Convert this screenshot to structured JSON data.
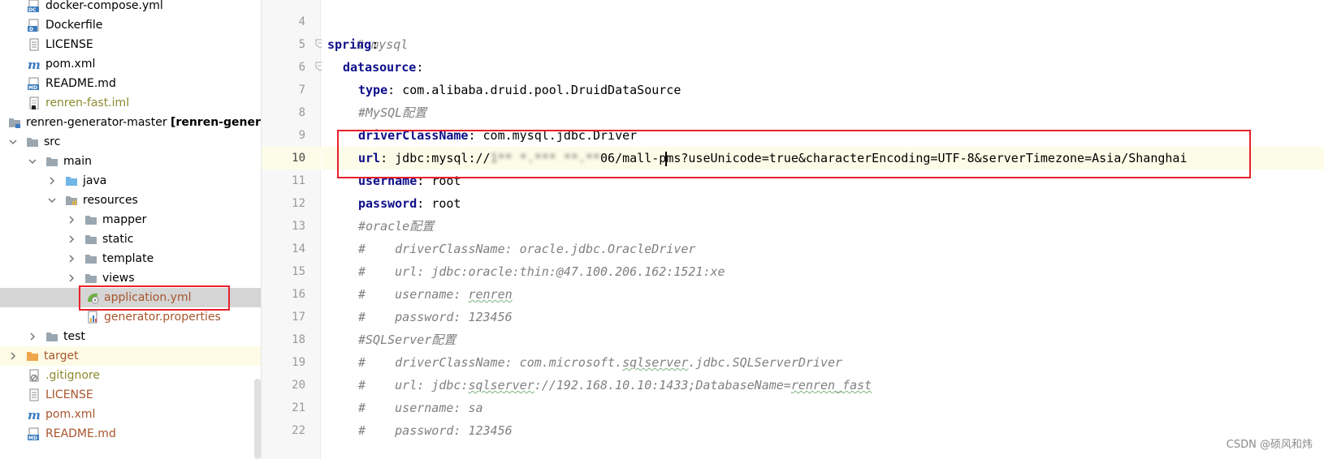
{
  "tree": {
    "items": [
      {
        "label": "docker-compose.yml",
        "icon": "docker-compose-file-icon"
      },
      {
        "label": "Dockerfile",
        "icon": "dockerfile-icon"
      },
      {
        "label": "LICENSE",
        "icon": "text-file-icon"
      },
      {
        "label": "pom.xml",
        "icon": "maven-file-icon"
      },
      {
        "label": "README.md",
        "icon": "markdown-file-icon"
      },
      {
        "label": "renren-fast.iml",
        "icon": "iml-file-icon"
      },
      {
        "label": "renren-generator-master",
        "bold": "[renren-generator]",
        "icon": "module-folder-icon"
      },
      {
        "label": "src",
        "icon": "folder-icon"
      },
      {
        "label": "main",
        "icon": "folder-icon"
      },
      {
        "label": "java",
        "icon": "source-folder-icon"
      },
      {
        "label": "resources",
        "icon": "resources-folder-icon"
      },
      {
        "label": "mapper",
        "icon": "folder-icon"
      },
      {
        "label": "static",
        "icon": "folder-icon"
      },
      {
        "label": "template",
        "icon": "folder-icon"
      },
      {
        "label": "views",
        "icon": "folder-icon"
      },
      {
        "label": "application.yml",
        "icon": "spring-config-icon"
      },
      {
        "label": "generator.properties",
        "icon": "properties-file-icon"
      },
      {
        "label": "test",
        "icon": "folder-icon"
      },
      {
        "label": "target",
        "icon": "excluded-folder-icon"
      },
      {
        "label": ".gitignore",
        "icon": "gitignore-file-icon"
      },
      {
        "label": "LICENSE",
        "icon": "text-file-icon"
      },
      {
        "label": "pom.xml",
        "icon": "maven-file-icon"
      },
      {
        "label": "README.md",
        "icon": "markdown-file-icon"
      }
    ]
  },
  "editor": {
    "line_numbers": [
      "4",
      "5",
      "6",
      "7",
      "8",
      "9",
      "10",
      "11",
      "12",
      "13",
      "14",
      "15",
      "16",
      "17",
      "18",
      "19",
      "20",
      "21",
      "22"
    ],
    "current_line": "10",
    "lines": {
      "l4": "# mysql",
      "l5_key": "spring",
      "l6_key": "datasource",
      "l7_key": "type",
      "l7_val": "com.alibaba.druid.pool.DruidDataSource",
      "l8": "#MySQL配置",
      "l9_key": "driverClassName",
      "l9_val": "com.mysql.jdbc.Driver",
      "l10_key": "url",
      "l10_prefix": "jdbc:mysql://",
      "l10_redacted": "1** *.*** **.**",
      "l10_mid": "06/mall-p",
      "l10_suffix": "ms?useUnicode=true&characterEncoding=UTF-8&serverTimezone=Asia/Shanghai",
      "l11_key": "username",
      "l11_val": "root",
      "l12_key": "password",
      "l12_val": "root",
      "l13": "#oracle配置",
      "l14": "#    driverClassName: oracle.jdbc.OracleDriver",
      "l15": "#    url: jdbc:oracle:thin:@47.100.206.162:1521:xe",
      "l16a": "#    username: ",
      "l16b": "renren",
      "l17": "#    password: 123456",
      "l18": "#SQLServer配置",
      "l19a": "#    driverClassName: com.microsoft.",
      "l19b": "sqlserver",
      "l19c": ".jdbc.SQLServerDriver",
      "l20a": "#    url: jdbc:",
      "l20b": "sqlserver",
      "l20c": "://192.168.10.10:1433;DatabaseName=",
      "l20d": "renren_fast",
      "l21": "#    username: sa",
      "l22": "#    password: 123456"
    }
  },
  "watermark": "CSDN @硕风和炜",
  "colors": {
    "highlight_box": "#e8202b",
    "yaml_key": "#0d0d8a",
    "comment": "#808080",
    "modified_file": "#a8552d"
  }
}
